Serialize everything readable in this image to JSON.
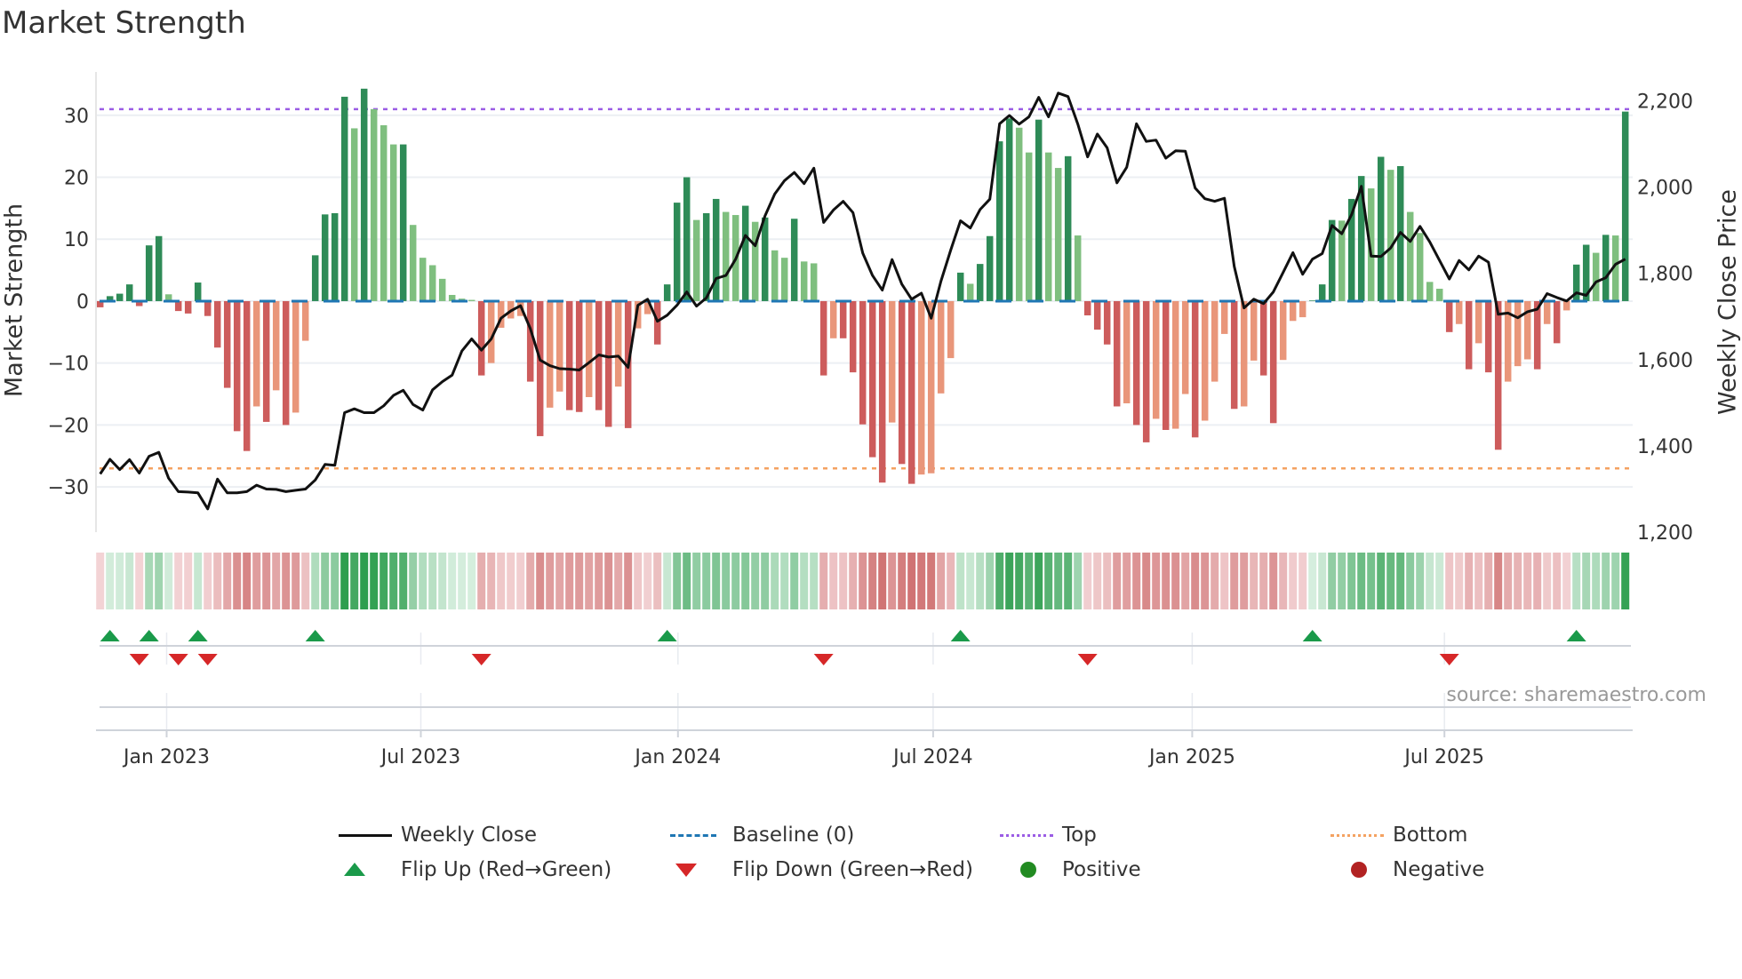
{
  "title": "Market Strength",
  "source": "source: sharemaestro.com",
  "colors": {
    "pos_strong": "#2e8b57",
    "pos_weak": "#7fbf7f",
    "neg_strong": "#cd5c5c",
    "neg_weak": "#e9967a",
    "price": "#111111",
    "baseline": "#1f77b4",
    "top": "#9b5de5",
    "bottom": "#f4a261",
    "flip_up": "#1a9a4a",
    "flip_down": "#d62728",
    "positive": "#228b22",
    "negative": "#b22222"
  },
  "legend": [
    {
      "label": "Weekly Close",
      "symbol": "line"
    },
    {
      "label": "Baseline (0)",
      "symbol": "dash"
    },
    {
      "label": "Top",
      "symbol": "dot-top"
    },
    {
      "label": "Bottom",
      "symbol": "dot-bottom"
    },
    {
      "label": "Flip Up (Red→Green)",
      "symbol": "triangle-up"
    },
    {
      "label": "Flip Down (Green→Red)",
      "symbol": "triangle-down"
    },
    {
      "label": "Positive",
      "symbol": "circle-pos"
    },
    {
      "label": "Negative",
      "symbol": "circle-neg"
    }
  ],
  "chart_data": {
    "type": "bar",
    "title": "Market Strength",
    "ylabel": "Market Strength",
    "ylabel_right": "Weekly Close Price",
    "x_unit": "week index",
    "ylim": [
      -37.3,
      37
    ],
    "ylim_right": [
      1200,
      2267
    ],
    "yticks": [
      {
        "value": 30,
        "label": "30"
      },
      {
        "value": 20,
        "label": "20"
      },
      {
        "value": 10,
        "label": "10"
      },
      {
        "value": 0,
        "label": "0"
      },
      {
        "value": -10,
        "label": "−10"
      },
      {
        "value": -20,
        "label": "−20"
      },
      {
        "value": -30,
        "label": "−30"
      }
    ],
    "yticks_right": [
      {
        "value": 2200,
        "label": "2,200"
      },
      {
        "value": 2000,
        "label": "2,000"
      },
      {
        "value": 1800,
        "label": "1,800"
      },
      {
        "value": 1600,
        "label": "1,600"
      },
      {
        "value": 1400,
        "label": "1,400"
      },
      {
        "value": 1200,
        "label": "1,200"
      }
    ],
    "xticks": [
      {
        "value": 6.8,
        "label": "Jan 2023"
      },
      {
        "value": 32.8,
        "label": "Jul 2023"
      },
      {
        "value": 59.1,
        "label": "Jan 2024"
      },
      {
        "value": 85.2,
        "label": "Jul 2024"
      },
      {
        "value": 111.7,
        "label": "Jan 2025"
      },
      {
        "value": 137.5,
        "label": "Jul 2025"
      }
    ],
    "top_level": 31,
    "bottom_level": -27,
    "baseline": 0,
    "grid": true,
    "legend_position": "bottom",
    "strength": [
      -1,
      0.8,
      1.2,
      2.7,
      -0.8,
      9,
      10.5,
      1.1,
      -1.6,
      -2,
      3,
      -2.4,
      -7.5,
      -14,
      -21,
      -24.2,
      -17,
      -19.5,
      -14.4,
      -20,
      -18,
      -6.4,
      7.4,
      14,
      14.2,
      33,
      27.9,
      34.3,
      31,
      28.4,
      25.3,
      25.3,
      12.3,
      7,
      5.8,
      3.6,
      1,
      0.4,
      0.2,
      -12,
      -10,
      -4.3,
      -2.8,
      -2.4,
      -13,
      -21.8,
      -17.2,
      -14.6,
      -17.6,
      -17.9,
      -15.5,
      -17.6,
      -20.3,
      -13.8,
      -20.5,
      -4.4,
      -2.1,
      -7,
      2.7,
      15.9,
      20,
      13.1,
      14.2,
      16.5,
      14.4,
      13.9,
      15.4,
      12.8,
      13.5,
      8.2,
      7,
      13.3,
      6.4,
      6.1,
      -12,
      -6,
      -6,
      -11.5,
      -19.9,
      -25.2,
      -29.3,
      -19.6,
      -26.3,
      -29.5,
      -28,
      -27.8,
      -14.9,
      -9.2,
      4.6,
      2.8,
      6,
      10.5,
      25.8,
      29.5,
      28,
      24,
      29.3,
      24,
      21.5,
      23.4,
      10.6,
      -2.3,
      -4.6,
      -7,
      -17,
      -16.5,
      -20,
      -22.8,
      -19,
      -20.8,
      -20.6,
      -15,
      -22,
      -19.3,
      -13,
      -5.3,
      -17.4,
      -17,
      -9.6,
      -12,
      -19.7,
      -9.5,
      -3.2,
      -2.6,
      0.1,
      2.7,
      13.1,
      13,
      16.5,
      20.2,
      18.2,
      23.3,
      21.2,
      21.8,
      14.4,
      11,
      3.1,
      2,
      -5,
      -3.7,
      -11,
      -6.8,
      -11.5,
      -24,
      -13,
      -10.5,
      -9.4,
      -11,
      -3.7,
      -6.8,
      -1.5,
      5.9,
      9.1,
      7.8,
      10.7,
      10.6,
      30.6
    ],
    "weekly_close": [
      1335,
      1369,
      1345,
      1368,
      1337,
      1376,
      1385,
      1325,
      1294,
      1293,
      1291,
      1254,
      1323,
      1291,
      1291,
      1294,
      1309,
      1300,
      1299,
      1294,
      1297,
      1300,
      1321,
      1357,
      1355,
      1477,
      1486,
      1477,
      1477,
      1493,
      1517,
      1529,
      1496,
      1483,
      1530,
      1549,
      1564,
      1620,
      1648,
      1622,
      1648,
      1696,
      1713,
      1725,
      1672,
      1599,
      1586,
      1579,
      1578,
      1576,
      1593,
      1611,
      1606,
      1608,
      1582,
      1726,
      1740,
      1689,
      1703,
      1726,
      1757,
      1724,
      1743,
      1788,
      1795,
      1833,
      1888,
      1864,
      1933,
      1984,
      2015,
      2034,
      2008,
      2044,
      1918,
      1947,
      1967,
      1941,
      1847,
      1795,
      1761,
      1832,
      1775,
      1740,
      1754,
      1696,
      1782,
      1854,
      1922,
      1905,
      1948,
      1972,
      2147,
      2166,
      2146,
      2163,
      2208,
      2163,
      2218,
      2210,
      2146,
      2070,
      2123,
      2091,
      2010,
      2046,
      2147,
      2106,
      2109,
      2067,
      2084,
      2083,
      1998,
      1973,
      1967,
      1974,
      1816,
      1720,
      1740,
      1730,
      1757,
      1802,
      1848,
      1798,
      1833,
      1846,
      1911,
      1892,
      1936,
      2002,
      1840,
      1839,
      1859,
      1895,
      1874,
      1909,
      1873,
      1830,
      1787,
      1830,
      1808,
      1840,
      1826,
      1705,
      1708,
      1697,
      1711,
      1717,
      1753,
      1744,
      1736,
      1755,
      1749,
      1780,
      1790,
      1821,
      1833
    ],
    "flip_up_weeks": [
      1,
      5,
      10,
      22,
      58,
      88,
      124,
      151
    ],
    "flip_down_weeks": [
      4,
      8,
      11,
      39,
      74,
      101,
      138
    ]
  }
}
